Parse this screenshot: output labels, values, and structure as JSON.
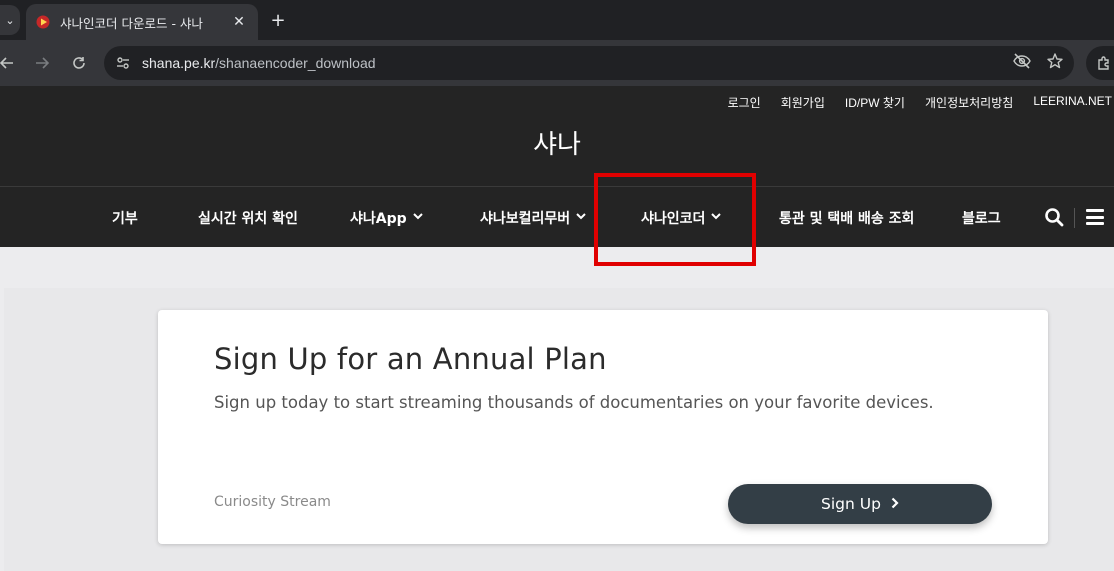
{
  "browser": {
    "tab_title": "샤나인코더 다운로드 - 샤나",
    "url_domain": "shana.pe.kr",
    "url_path": "/shanaencoder_download"
  },
  "site": {
    "util_links": [
      "로그인",
      "회원가입",
      "ID/PW 찾기",
      "개인정보처리방침",
      "LEERINA.NET"
    ],
    "brand": "샤나",
    "nav": [
      {
        "label": "기부",
        "has_dropdown": false
      },
      {
        "label": "실시간 위치 확인",
        "has_dropdown": false
      },
      {
        "label": "샤나App",
        "has_dropdown": true
      },
      {
        "label": "샤나보컬리무버",
        "has_dropdown": true
      },
      {
        "label": "샤나인코더",
        "has_dropdown": true
      },
      {
        "label": "통관 및 택배 배송 조회",
        "has_dropdown": false
      },
      {
        "label": "블로그",
        "has_dropdown": false
      }
    ]
  },
  "ad_card": {
    "title": "Sign Up for an Annual Plan",
    "description": "Sign up today to start streaming thousands of documentaries on your favorite devices.",
    "source": "Curiosity Stream",
    "button_label": "Sign Up"
  },
  "colors": {
    "highlight": "#e00000",
    "header_bg": "#242424",
    "button_bg": "#333e46"
  }
}
